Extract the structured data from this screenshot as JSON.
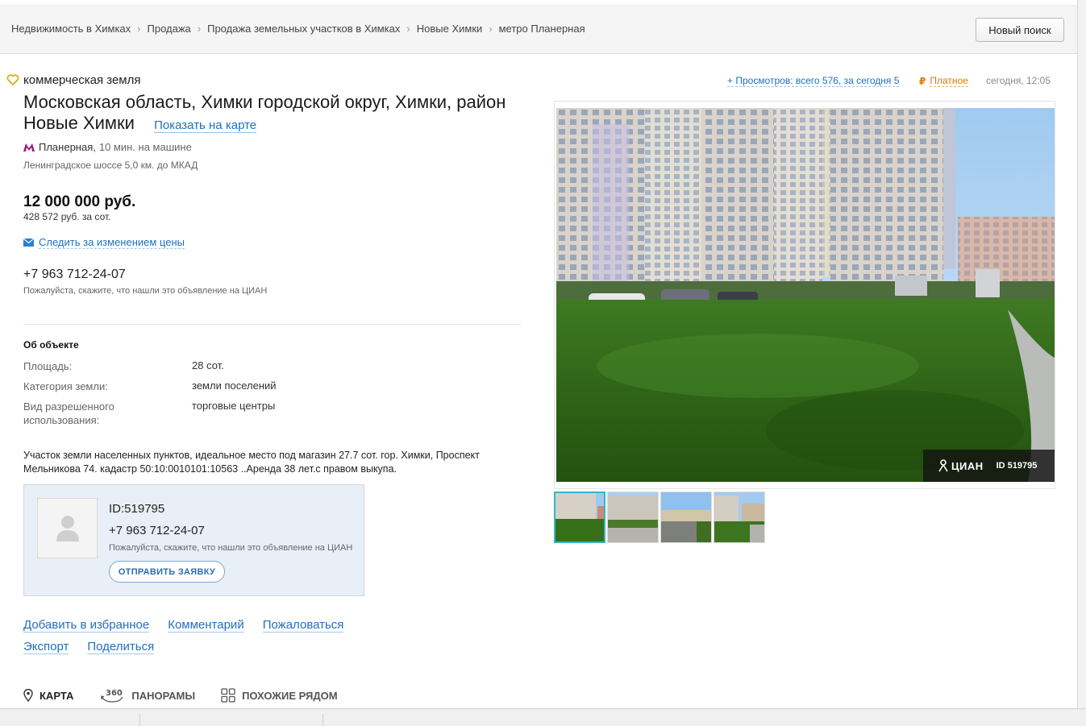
{
  "breadcrumbs": [
    "Недвижимость в Химках",
    "Продажа",
    "Продажа земельных участков в Химках",
    "Новые Химки",
    "метро Планерная"
  ],
  "new_search_label": "Новый поиск",
  "listing": {
    "category": "коммерческая земля",
    "address": "Московская область, Химки городской округ, Химки, район Новые Химки",
    "show_on_map": "Показать на карте",
    "metro_station": "Планерная,",
    "metro_distance": "10 мин. на машине",
    "highway": "Ленинградское шоссе 5,0 км. до МКАД",
    "price": "12 000 000 руб.",
    "price_per_unit": "428 572 руб. за сот.",
    "watch_price": "Следить за изменением цены",
    "phone": "+7 963 712-24-07",
    "please_text": "Пожалуйста, скажите, что нашли это объявление на ЦИАН"
  },
  "meta": {
    "views": "+ Просмотров: всего 576, за сегодня 5",
    "paid": "Платное",
    "datetime": "сегодня, 12:05"
  },
  "about": {
    "title": "Об объекте",
    "rows": [
      {
        "label": "Площадь:",
        "value": "28 сот."
      },
      {
        "label": "Категория земли:",
        "value": "земли поселений"
      },
      {
        "label": "Вид разрешенного использования:",
        "value": "торговые центры"
      }
    ]
  },
  "description": "Участок земли населенных пунктов, идеальное место под магазин 27.7 сот. гор. Химки, Проспект Мельникова 74. кадастр 50:10:0010101:10563 ..Аренда 38 лет.с правом выкупа.",
  "contact_card": {
    "id": "ID:519795",
    "phone": "+7 963 712-24-07",
    "please_text": "Пожалуйста, скажите, что нашли это объявление на ЦИАН",
    "send_button": "ОТПРАВИТЬ ЗАЯВКУ"
  },
  "actions": {
    "row1": [
      "Добавить в избранное",
      "Комментарий",
      "Пожаловаться"
    ],
    "row2": [
      "Экспорт",
      "Поделиться"
    ]
  },
  "tabs": [
    "КАРТА",
    "ПАНОРАМЫ",
    "ПОХОЖИЕ РЯДОМ"
  ],
  "photo": {
    "watermark": "ЦИАН",
    "id_label": "ID 519795"
  },
  "colors": {
    "link": "#1f6fbf",
    "paid": "#e07b00",
    "metro": "#a3187a",
    "card_bg": "#e8eff6",
    "active_thumb": "#33b5c9"
  },
  "icons": [
    "heart-icon",
    "metro-icon",
    "envelope-icon",
    "user-icon",
    "map-pin-icon",
    "panorama-360-icon",
    "grid-icon",
    "ruble-icon"
  ]
}
